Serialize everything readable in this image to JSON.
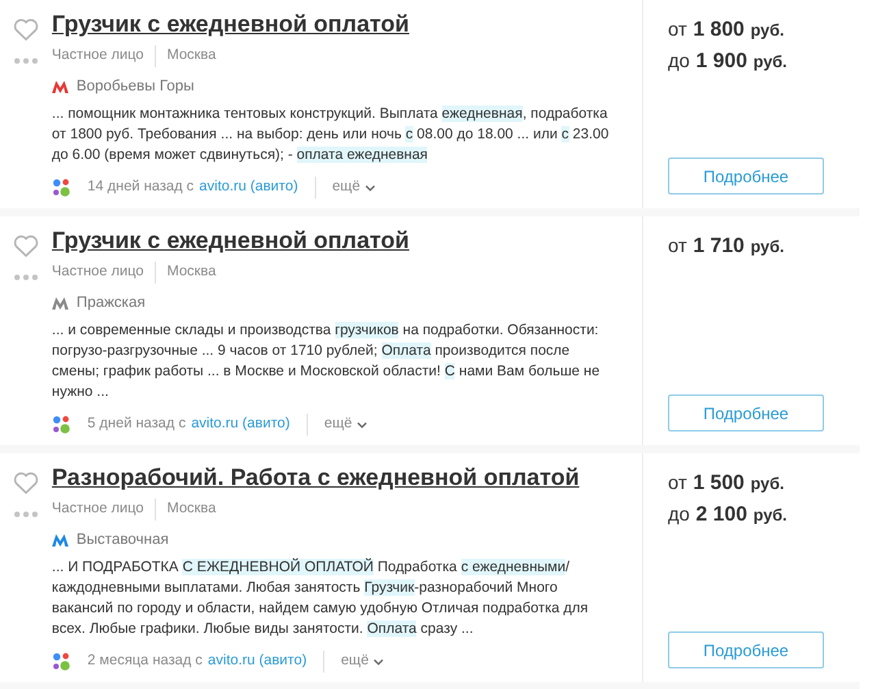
{
  "listings": [
    {
      "title": "Грузчик с ежедневной оплатой",
      "seller": "Частное лицо",
      "city": "Москва",
      "metro": {
        "station": "Воробьевы Горы",
        "color": "#e53935"
      },
      "description": [
        {
          "text": "... помощник монтажника тентовых конструкций. Выплата ",
          "highlight": false
        },
        {
          "text": "ежедневная",
          "highlight": true
        },
        {
          "text": ", подработка от 1800 руб. Требования ... на выбор: день или ночь ",
          "highlight": false
        },
        {
          "text": "с",
          "highlight": true
        },
        {
          "text": " 08.00 до 18.00 ... или ",
          "highlight": false
        },
        {
          "text": "с",
          "highlight": true
        },
        {
          "text": " 23.00 до 6.00 (время может сдвинуться); - ",
          "highlight": false
        },
        {
          "text": "оплата ежедневная",
          "highlight": true
        }
      ],
      "posted": "14 дней назад с",
      "source": "avito.ru (авито)",
      "more": "ещё",
      "prices": [
        {
          "prefix": "от",
          "amount": "1 800",
          "unit": "руб."
        },
        {
          "prefix": "до",
          "amount": "1 900",
          "unit": "руб."
        }
      ],
      "button": "Подробнее"
    },
    {
      "title": "Грузчик с ежедневной оплатой",
      "seller": "Частное лицо",
      "city": "Москва",
      "metro": {
        "station": "Пражская",
        "color": "#8a8a8a"
      },
      "description": [
        {
          "text": "... и современные склады и производства ",
          "highlight": false
        },
        {
          "text": "грузчиков",
          "highlight": true
        },
        {
          "text": " на подработки. Обязанности: погрузо-разгрузочные ... 9 часов от 1710 рублей; ",
          "highlight": false
        },
        {
          "text": "Оплата",
          "highlight": true
        },
        {
          "text": " производится после смены; график работы ... в Москве и Московской области! ",
          "highlight": false
        },
        {
          "text": "С",
          "highlight": true
        },
        {
          "text": " нами Вам больше не нужно ...",
          "highlight": false
        }
      ],
      "posted": "5 дней назад с",
      "source": "avito.ru (авито)",
      "more": "ещё",
      "prices": [
        {
          "prefix": "от",
          "amount": "1 710",
          "unit": "руб."
        }
      ],
      "button": "Подробнее"
    },
    {
      "title": "Разнорабочий. Работа с ежедневной оплатой",
      "seller": "Частное лицо",
      "city": "Москва",
      "metro": {
        "station": "Выставочная",
        "color": "#1e88e5"
      },
      "description": [
        {
          "text": "... И ПОДРАБОТКА ",
          "highlight": false
        },
        {
          "text": "С ЕЖЕДНЕВНОЙ ОПЛАТОЙ",
          "highlight": true
        },
        {
          "text": " Подработка ",
          "highlight": false
        },
        {
          "text": "с ежедневными",
          "highlight": true
        },
        {
          "text": "/каждодневными выплатами. Любая занятость ",
          "highlight": false
        },
        {
          "text": "Грузчик",
          "highlight": true
        },
        {
          "text": "-разнорабочий Много вакансий по городу и области, найдем самую удобную Отличая подработка для всех. Любые графики. Любые виды занятости. ",
          "highlight": false
        },
        {
          "text": "Оплата",
          "highlight": true
        },
        {
          "text": " сразу ...",
          "highlight": false
        }
      ],
      "posted": "2 месяца назад с",
      "source": "avito.ru (авито)",
      "more": "ещё",
      "prices": [
        {
          "prefix": "от",
          "amount": "1 500",
          "unit": "руб."
        },
        {
          "prefix": "до",
          "amount": "2 100",
          "unit": "руб."
        }
      ],
      "button": "Подробнее"
    }
  ]
}
